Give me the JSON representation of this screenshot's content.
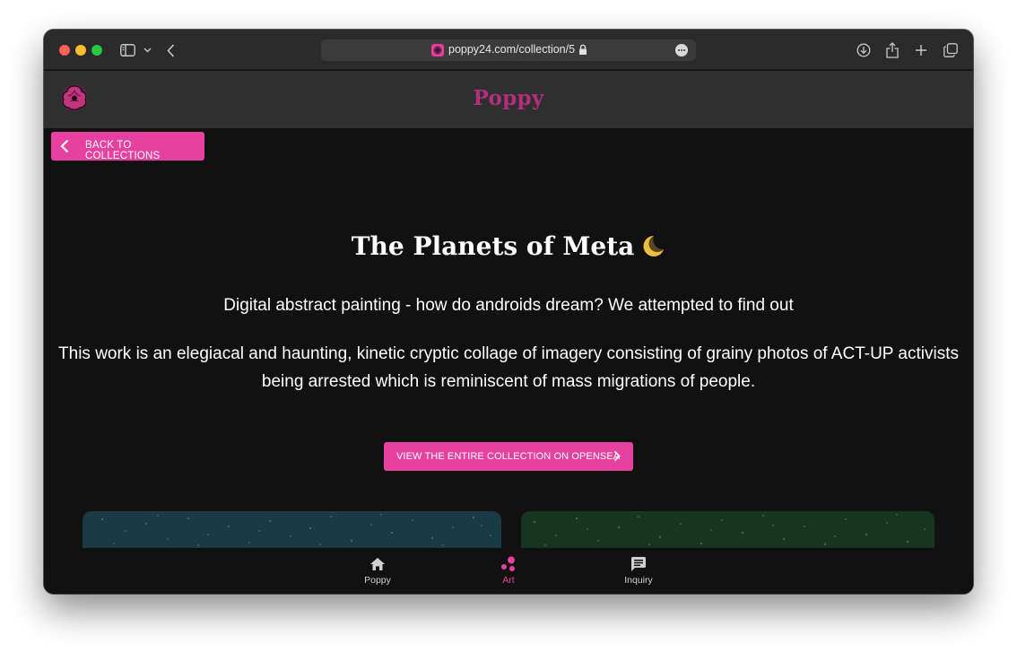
{
  "browser": {
    "url": "poppy24.com/collection/5"
  },
  "header": {
    "brand": "Poppy"
  },
  "content": {
    "back_label": "BACK TO COLLECTIONS",
    "title": "The Planets of Meta",
    "subtitle": "Digital abstract painting - how do androids dream? We attempted to find out",
    "description": "This work is an elegiacal and haunting, kinetic cryptic collage of imagery consisting of grainy photos of ACT-UP activists being arrested which is reminiscent of mass migrations of people.",
    "opensea_label": "VIEW THE ENTIRE COLLECTION ON OPENSEA"
  },
  "bottom_nav": {
    "items": [
      {
        "label": "Poppy",
        "icon": "home-icon",
        "active": false
      },
      {
        "label": "Art",
        "icon": "art-icon",
        "active": true
      },
      {
        "label": "Inquiry",
        "icon": "chat-icon",
        "active": false
      }
    ]
  },
  "colors": {
    "accent": "#e640a0",
    "brand": "#b12f7e",
    "background": "#111111",
    "header": "#2f2f2f",
    "nav_inactive": "#d0d0d0"
  }
}
